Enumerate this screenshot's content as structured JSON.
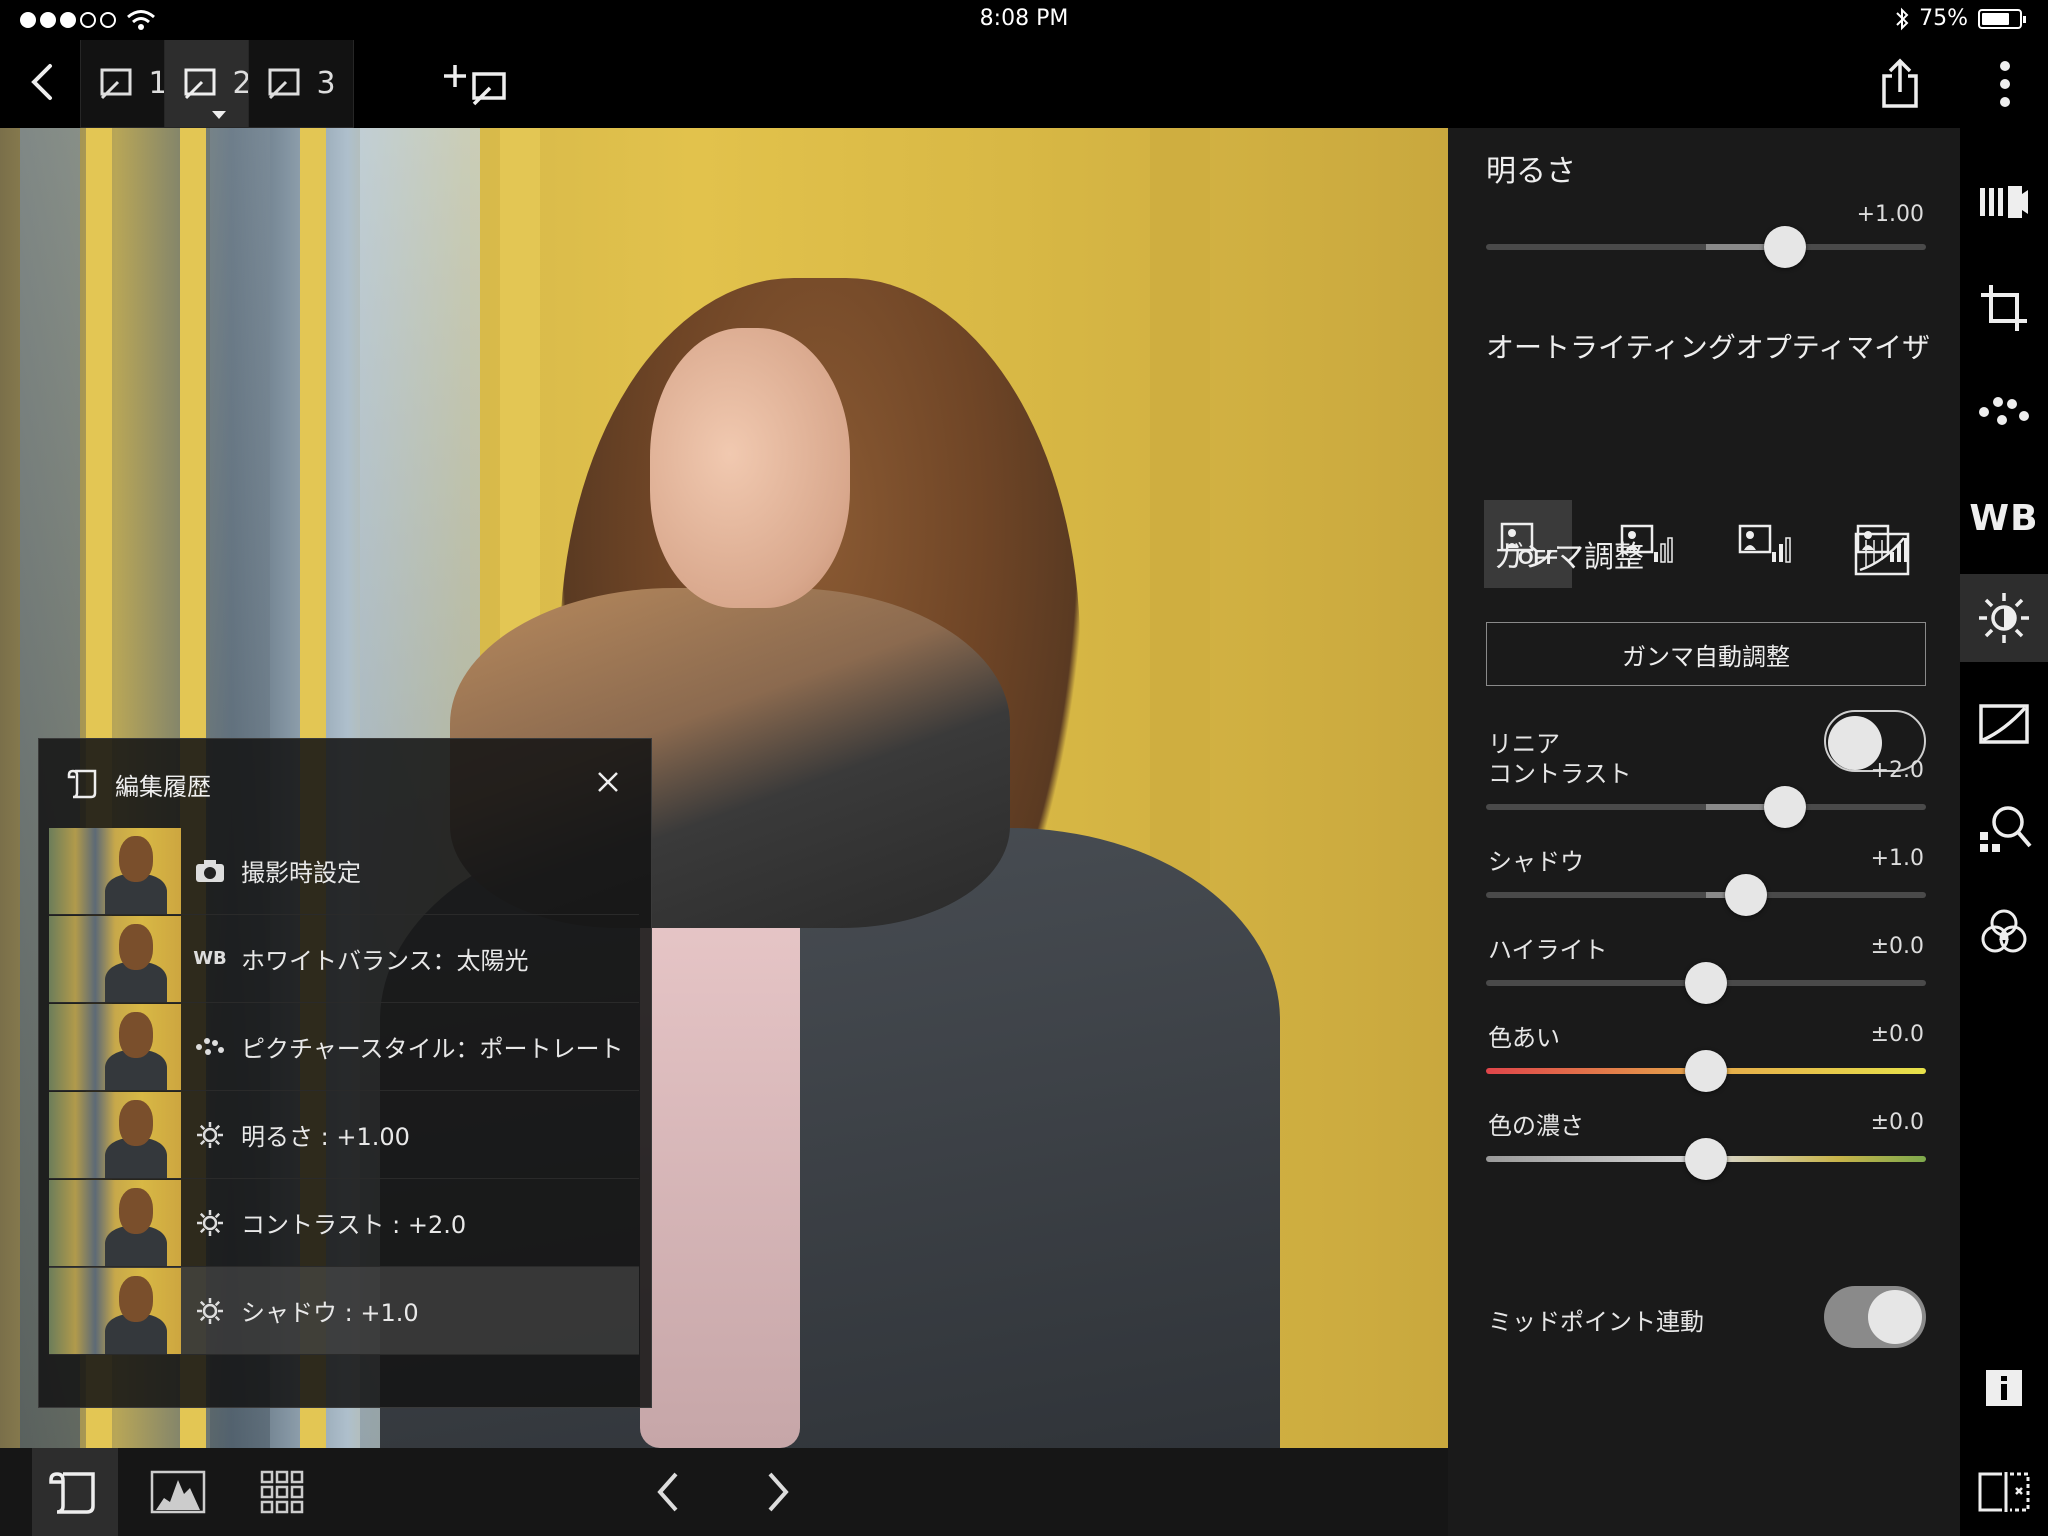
{
  "status_bar": {
    "time": "8:08 PM",
    "battery": "75%",
    "battery_level": 0.75
  },
  "toolbar": {
    "tabs": [
      {
        "number": "1"
      },
      {
        "number": "2",
        "active": true
      },
      {
        "number": "3"
      }
    ]
  },
  "history": {
    "title": "編集履歴",
    "rows": [
      {
        "icon": "camera-icon",
        "label": "撮影時設定"
      },
      {
        "icon": "wb-icon",
        "badge": "WB",
        "label": "ホワイトバランス：太陽光"
      },
      {
        "icon": "picture-style-icon",
        "label": "ピクチャースタイル：ポートレート"
      },
      {
        "icon": "brightness-icon",
        "label": "明るさ : +1.00"
      },
      {
        "icon": "brightness-icon",
        "label": "コントラスト : +2.0"
      },
      {
        "icon": "brightness-icon",
        "label": "シャドウ : +1.0",
        "selected": true
      }
    ]
  },
  "panel": {
    "brightness": {
      "title": "明るさ",
      "value": "+1.00",
      "position": 0.68
    },
    "alo": {
      "title": "オートライティングオプティマイザ",
      "off_label": "OFF"
    },
    "gamma": {
      "title": "ガンマ調整",
      "auto_button": "ガンマ自動調整"
    },
    "linear": {
      "label": "リニア",
      "on": false
    },
    "sliders": [
      {
        "label": "コントラスト",
        "value": "+2.0",
        "position": 0.68,
        "style": "gray"
      },
      {
        "label": "シャドウ",
        "value": "+1.0",
        "position": 0.59,
        "style": "gray"
      },
      {
        "label": "ハイライト",
        "value": "±0.0",
        "position": 0.5,
        "style": "gray"
      },
      {
        "label": "色あい",
        "value": "±0.0",
        "position": 0.5,
        "style": "hue"
      },
      {
        "label": "色の濃さ",
        "value": "±0.0",
        "position": 0.5,
        "style": "sat"
      }
    ],
    "midpoint": {
      "label": "ミッドポイント連動",
      "on": true
    }
  },
  "rail": {
    "items": [
      {
        "icon": "tone-curve-strip-icon"
      },
      {
        "icon": "crop-icon"
      },
      {
        "icon": "picture-style-icon"
      },
      {
        "icon": "wb-icon",
        "text": "WB"
      },
      {
        "icon": "brightness-icon",
        "active": true
      },
      {
        "icon": "curve-icon"
      },
      {
        "icon": "detail-zoom-icon"
      },
      {
        "icon": "color-adjust-icon"
      },
      {
        "icon": "info-icon"
      },
      {
        "icon": "compare-icon"
      }
    ]
  }
}
